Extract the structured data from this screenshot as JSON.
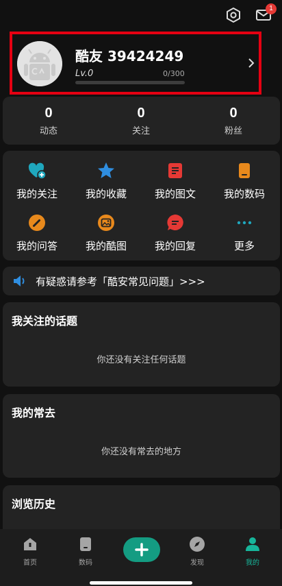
{
  "header": {
    "settings_icon": "settings-gear-icon",
    "mail_icon": "mail-icon",
    "mail_badge": "1"
  },
  "profile": {
    "username": "酷友 39424249",
    "level": "Lv.0",
    "xp": "0/300",
    "xp_progress": 0
  },
  "stats": [
    {
      "value": "0",
      "label": "动态"
    },
    {
      "value": "0",
      "label": "关注"
    },
    {
      "value": "0",
      "label": "粉丝"
    }
  ],
  "menu": [
    {
      "label": "我的关注",
      "icon": "heart-plus-icon",
      "color": "#1fa7bd"
    },
    {
      "label": "我的收藏",
      "icon": "star-icon",
      "color": "#2f8ee0"
    },
    {
      "label": "我的图文",
      "icon": "document-icon",
      "color": "#e53935"
    },
    {
      "label": "我的数码",
      "icon": "phone-icon",
      "color": "#e8891c"
    },
    {
      "label": "我的问答",
      "icon": "pencil-icon",
      "color": "#e8891c"
    },
    {
      "label": "我的酷图",
      "icon": "image-icon",
      "color": "#e8891c"
    },
    {
      "label": "我的回复",
      "icon": "chat-icon",
      "color": "#e53935"
    },
    {
      "label": "更多",
      "icon": "more-dots-icon",
      "color": "#1fa7bd"
    }
  ],
  "notice": {
    "icon": "speaker-icon",
    "text": "有疑惑请参考「酷安常见问题」>>>"
  },
  "sections": {
    "topics": {
      "title": "我关注的话题",
      "empty": "你还没有关注任何话题"
    },
    "often": {
      "title": "我的常去",
      "empty": "你还没有常去的地方"
    },
    "history": {
      "title": "浏览历史"
    }
  },
  "nav": [
    {
      "label": "首页",
      "icon": "home-icon",
      "active": false
    },
    {
      "label": "数码",
      "icon": "phone-icon",
      "active": false
    },
    {
      "label": "",
      "icon": "plus-icon",
      "active": false
    },
    {
      "label": "发现",
      "icon": "compass-icon",
      "active": false
    },
    {
      "label": "我的",
      "icon": "person-icon",
      "active": true
    }
  ],
  "colors": {
    "accent": "#17b59a",
    "highlight_border": "#e50012",
    "card": "#232323",
    "background": "#111111"
  }
}
